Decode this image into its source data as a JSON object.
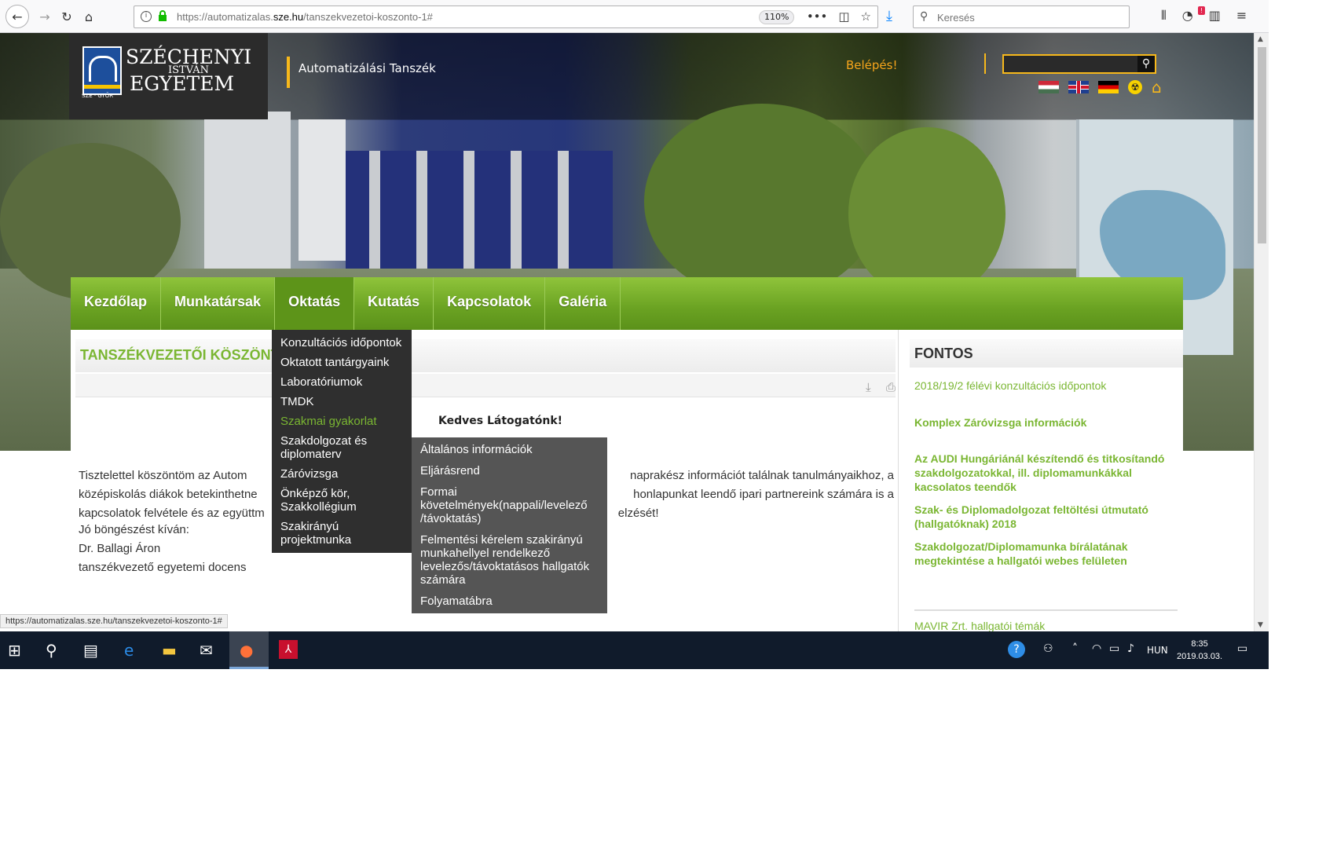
{
  "browser": {
    "url_prefix": "https://automatizalas.",
    "url_domain": "sze.hu",
    "url_path": "/tanszekvezetoi-koszonto-1#",
    "zoom": "110%",
    "search_placeholder": "Keresés"
  },
  "header": {
    "logo_line1": "SZÉCHENYI",
    "logo_line2": "ISTVÁN",
    "logo_line3": "EGYETEM",
    "logo_sub": "SZE · GYŐR",
    "department": "Automatizálási Tanszék",
    "login": "Belépés!"
  },
  "nav": {
    "items": [
      "Kezdőlap",
      "Munkatársak",
      "Oktatás",
      "Kutatás",
      "Kapcsolatok",
      "Galéria"
    ]
  },
  "dropdown": {
    "items": [
      "Konzultációs időpontok",
      "Oktatott tantárgyaink",
      "Laboratóriumok",
      "TMDK",
      "Szakmai gyakorlat",
      "Szakdolgozat és diplomaterv",
      "Záróvizsga",
      "Önképző kör, Szakkollégium",
      "Szakirányú projektmunka"
    ]
  },
  "submenu": {
    "items": [
      "Általános információk",
      "Eljárásrend",
      "Formai követelmények(nappali/levelező /távoktatás)",
      "Felmentési kérelem szakirányú munkahellyel rendelkező levelezős/távoktatásos hallgatók számára",
      "Folyamatábra"
    ]
  },
  "article": {
    "title": "TANSZÉKVEZETŐI KÖSZÖNTŐ",
    "greeting": "Kedves Látogatónk!",
    "paragraph": "Tisztelettel köszöntöm az Autom... naprakész információt találnak tanulmányaikhoz, a középiskolás diákok betekinthetne... honlapunkat leendő ipari partnereink számára is a kapcsolatok felvétele és az együttm... elzését!",
    "para_line1_a": "Tisztelettel köszöntöm az Autom",
    "para_line1_b": "naprakész információt találnak tanulmányaikhoz, a",
    "para_line2_a": "középiskolás diákok betekinthetne",
    "para_line2_b": "honlapunkat leendő ipari partnereink számára is a",
    "para_line3_a": "kapcsolatok felvétele és az együttm",
    "para_line3_b": "elzését!",
    "sig1": "Jó böngészést kíván:",
    "sig2": "Dr. Ballagi Áron",
    "sig3": "tanszékvezető egyetemi docens"
  },
  "sidebar": {
    "title": "FONTOS",
    "links": [
      "2018/19/2 félévi konzultációs időpontok",
      "Komplex Záróvizsga információk",
      "Az AUDI Hungáriánál készítendő és titkosítandó szakdolgozatokkal, ill. diplomamunkákkal kacsolatos teendők",
      "Szak- és Diplomadolgozat feltöltési útmutató (hallgatóknak) 2018",
      "Szakdolgozat/Diplomamunka bírálatának megtekintése a hallgatói webes felületen",
      "MAVIR Zrt.  hallgatói témák"
    ]
  },
  "statusbar": "https://automatizalas.sze.hu/tanszekvezetoi-koszonto-1#",
  "taskbar": {
    "lang": "HUN",
    "time": "8:35",
    "date": "2019.03.03."
  },
  "colors": {
    "accent_green": "#7ab632",
    "nav_green": "#6aa222",
    "accent_orange": "#f7a51b"
  }
}
